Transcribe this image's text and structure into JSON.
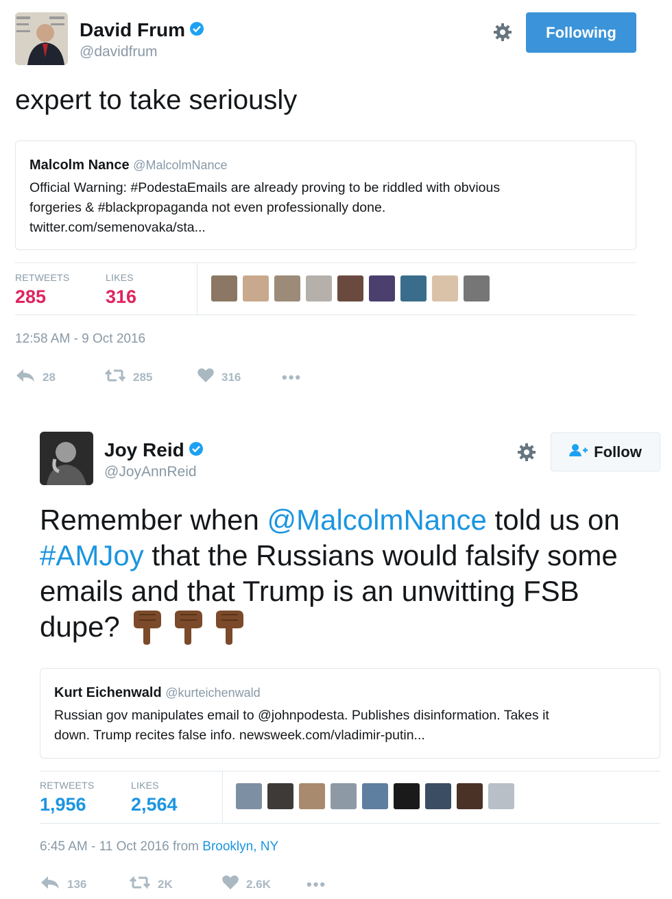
{
  "tweets": [
    {
      "author": {
        "name": "David Frum",
        "handle": "@davidfrum",
        "verified": true
      },
      "follow_button": "Following",
      "text": "expert to take seriously",
      "quoted": {
        "name": "Malcolm Nance",
        "handle": "@MalcolmNance",
        "lines": [
          "Official Warning: #PodestaEmails are already proving to be riddled with obvious",
          "forgeries & #blackpropaganda not even professionally done.",
          "twitter.com/semenovaka/sta..."
        ]
      },
      "stats": {
        "retweets_label": "RETWEETS",
        "retweets": "285",
        "likes_label": "LIKES",
        "likes": "316"
      },
      "timestamp": "12:58 AM - 9 Oct 2016",
      "actions": {
        "replies": "28",
        "retweets": "285",
        "likes": "316"
      }
    },
    {
      "author": {
        "name": "Joy Reid",
        "handle": "@JoyAnnReid",
        "verified": true
      },
      "follow_button": "Follow",
      "text": {
        "p1": "Remember when ",
        "mention": "@MalcolmNance",
        "p2": " told us on",
        "hashtag": "#AMJoy",
        "p3": " that the Russians would falsify some",
        "line3": "emails and that Trump is an unwitting FSB",
        "line4": "dupe?"
      },
      "quoted": {
        "name": "Kurt Eichenwald",
        "handle": "@kurteichenwald",
        "lines": [
          "Russian gov manipulates email to @johnpodesta. Publishes disinformation. Takes it",
          "down. Trump recites false info. newsweek.com/vladimir-putin..."
        ]
      },
      "stats": {
        "retweets_label": "RETWEETS",
        "retweets": "1,956",
        "likes_label": "LIKES",
        "likes": "2,564"
      },
      "timestamp_prefix": "6:45 AM - 11 Oct 2016 from ",
      "location": "Brooklyn, NY",
      "actions": {
        "replies": "136",
        "retweets": "2K",
        "likes": "2.6K"
      }
    }
  ],
  "colors": {
    "link": "#1b95e0",
    "like_count": "#e0245e",
    "retweet_count": "#e0245e",
    "joy_stats": "#1b95e0",
    "following_bg": "#3b94d9"
  },
  "icons": [
    "verified-badge-icon",
    "gear-icon",
    "reply-icon",
    "retweet-icon",
    "heart-icon",
    "more-icon",
    "follow-person-icon",
    "pointing-down-emoji"
  ]
}
